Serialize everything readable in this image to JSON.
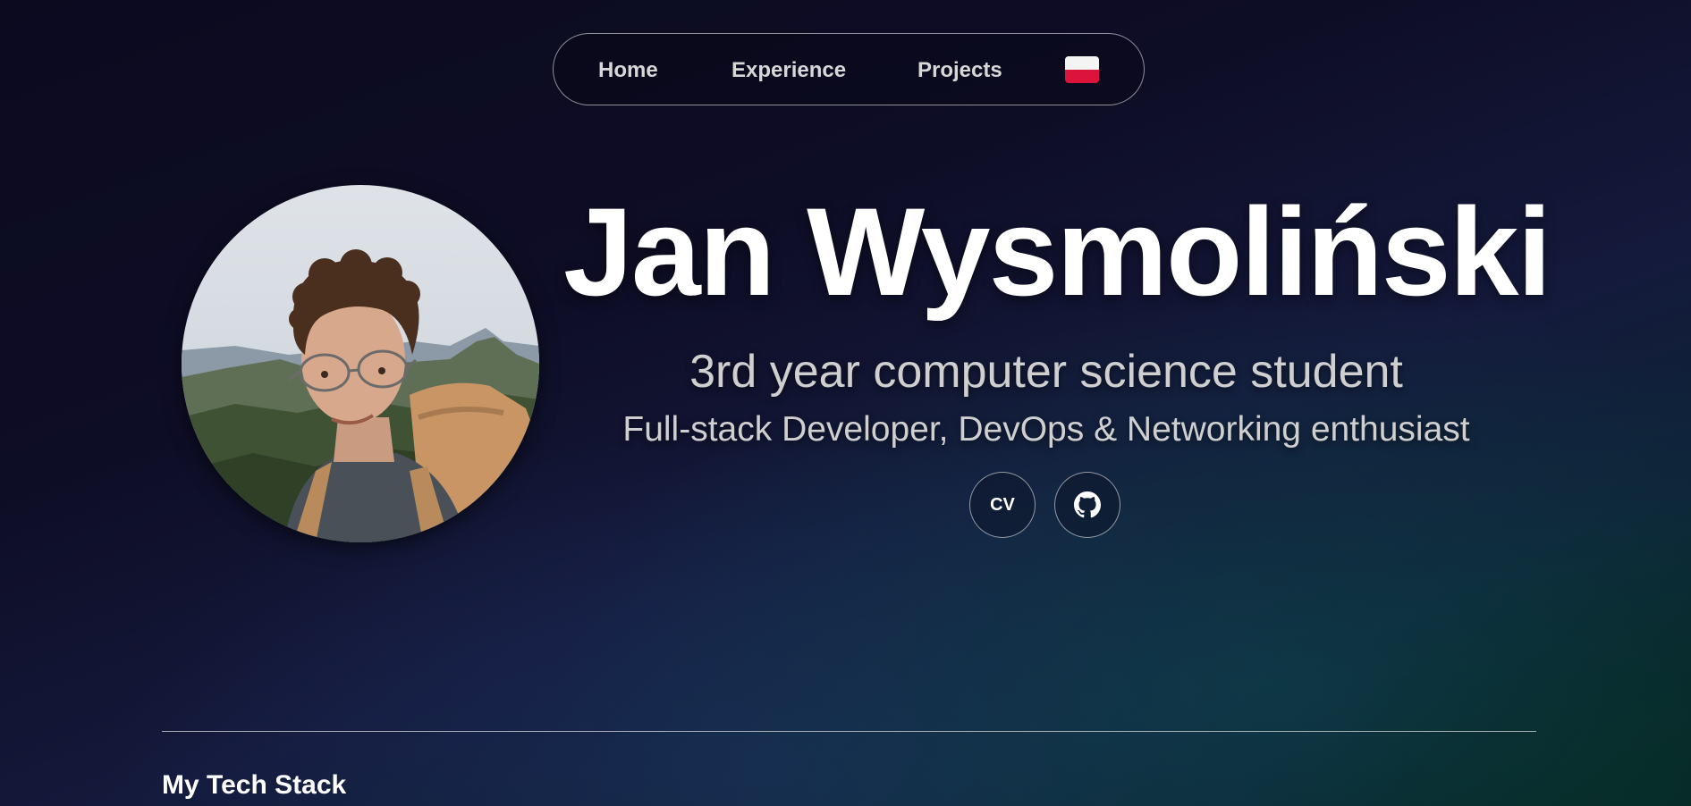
{
  "nav": {
    "links": [
      {
        "label": "Home"
      },
      {
        "label": "Experience"
      },
      {
        "label": "Projects"
      }
    ],
    "language_flag": "poland-flag-icon"
  },
  "hero": {
    "name": "Jan Wysmoliński",
    "subtitle": "3rd year computer science student",
    "tagline": "Full-stack Developer, DevOps & Networking enthusiast",
    "cv_label": "CV",
    "github_icon": "github-icon"
  },
  "tech_stack": {
    "title": "My Tech Stack"
  },
  "colors": {
    "flag_white": "#f4f4f4",
    "flag_red": "#dc143c",
    "text_primary": "#ffffff",
    "text_secondary": "#cfcfcf"
  }
}
